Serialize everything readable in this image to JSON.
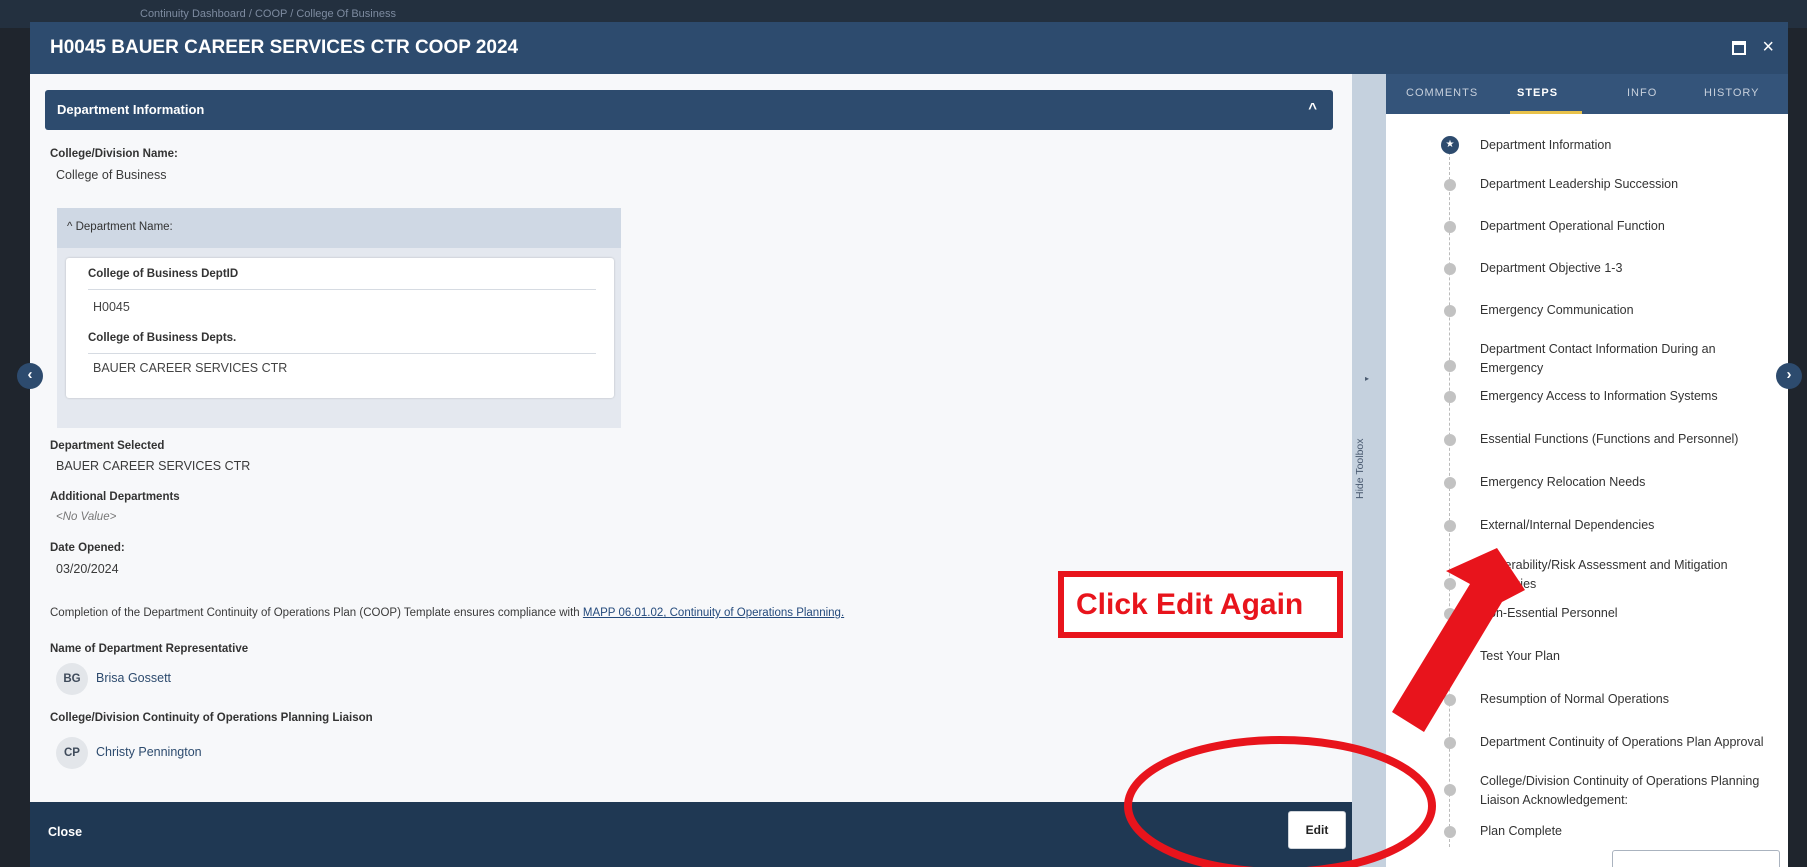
{
  "background": {
    "breadcrumb": "Continuity Dashboard  /  COOP  /  College Of Business"
  },
  "modal": {
    "title": "H0045 BAUER CAREER SERVICES CTR COOP 2024",
    "maximize_icon": "maximize-icon",
    "close_glyph": "×"
  },
  "section": {
    "title": "Department Information",
    "chevron": "^"
  },
  "fields": {
    "college_label": "College/Division Name:",
    "college_value": "College of Business",
    "dept_name_header": "^ Department Name:",
    "dept_id_label": "College of Business DeptID",
    "dept_id_value": "H0045",
    "depts_label": "College of Business Depts.",
    "depts_value": "BAUER CAREER SERVICES CTR",
    "dept_selected_label": "Department Selected",
    "dept_selected_value": "BAUER CAREER SERVICES CTR",
    "additional_label": "Additional Departments",
    "additional_value": "<No Value>",
    "date_label": "Date Opened:",
    "date_value": "03/20/2024",
    "completion_text": "Completion of the Department Continuity of Operations Plan (COOP) Template ensures compliance with",
    "completion_link": "MAPP 06.01.02, Continuity of Operations Planning.",
    "rep_label": "Name of Department Representative",
    "rep_initials": "BG",
    "rep_name": "Brisa Gossett",
    "liaison_label": "College/Division Continuity of Operations Planning Liaison",
    "liaison_initials": "CP",
    "liaison_name": "Christy Pennington"
  },
  "footer": {
    "close_label": "Close",
    "edit_label": "Edit"
  },
  "toolbox": {
    "arrow": "▸",
    "label": "Hide Toolbox"
  },
  "tabs": [
    "COMMENTS",
    "STEPS",
    "INFO",
    "HISTORY"
  ],
  "active_tab": "STEPS",
  "steps": [
    {
      "label": "Department Information",
      "active": true
    },
    {
      "label": "Department Leadership Succession"
    },
    {
      "label": "Department Operational Function"
    },
    {
      "label": "Department Objective 1-3"
    },
    {
      "label": "Emergency Communication"
    },
    {
      "label": "Department Contact Information During an Emergency"
    },
    {
      "label": "Emergency Access to Information Systems"
    },
    {
      "label": "Essential Functions (Functions and Personnel)"
    },
    {
      "label": "Emergency Relocation Needs"
    },
    {
      "label": "External/Internal Dependencies"
    },
    {
      "label": "Vulnerability/Risk Assessment and Mitigation Strategies"
    },
    {
      "label": "Non-Essential Personnel"
    },
    {
      "label": "Test Your Plan"
    },
    {
      "label": "Resumption of Normal Operations"
    },
    {
      "label": "Department Continuity of Operations Plan Approval"
    },
    {
      "label": "College/Division Continuity of Operations Planning Liaison Acknowledgement:"
    },
    {
      "label": "Plan Complete"
    }
  ],
  "step_marker": "★",
  "nav": {
    "prev_glyph": "‹",
    "next_glyph": "›"
  },
  "annotation": {
    "callout_text": "Click Edit Again",
    "color": "#e8141c"
  }
}
